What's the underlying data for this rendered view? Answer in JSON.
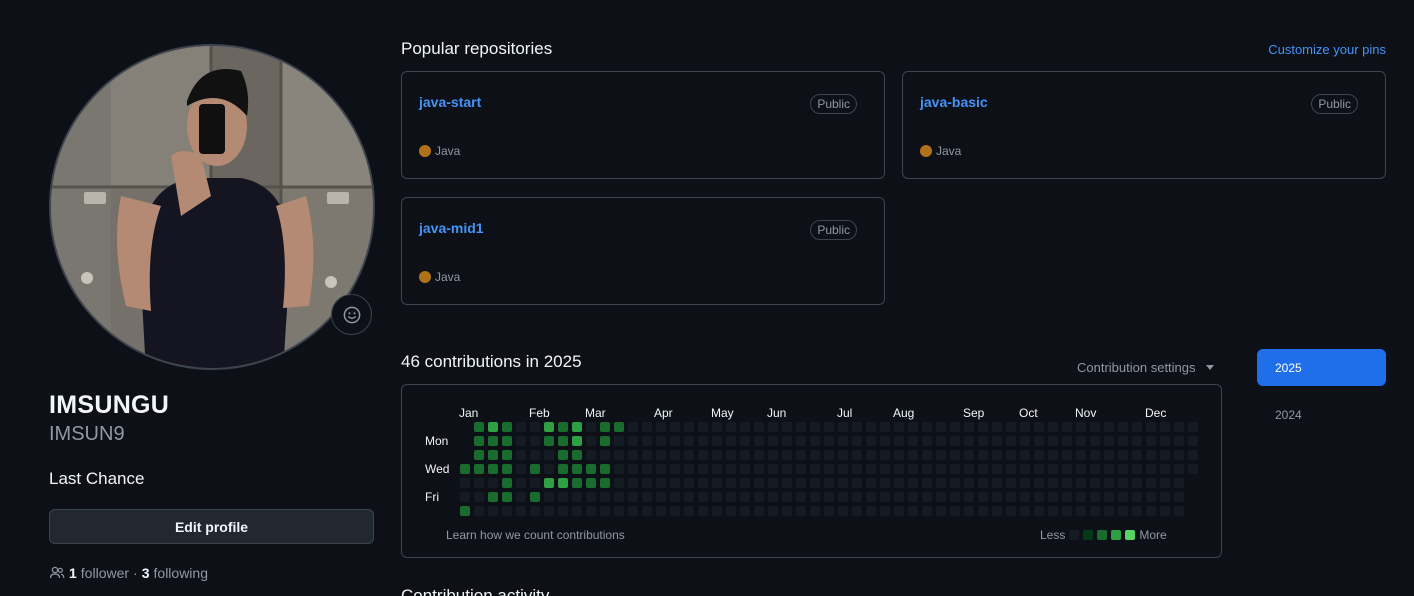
{
  "profile": {
    "full_name": "IMSUNGU",
    "username": "IMSUN9",
    "bio": "Last Chance",
    "edit_label": "Edit profile",
    "followers_count": "1",
    "followers_label": "follower",
    "separator": "·",
    "following_count": "3",
    "following_label": "following",
    "emoji_icon": "smiley-icon"
  },
  "pinned": {
    "title": "Popular repositories",
    "customize_label": "Customize your pins",
    "repos": [
      {
        "name": "java-start",
        "visibility": "Public",
        "language": "Java",
        "lang_color": "#b07219"
      },
      {
        "name": "java-basic",
        "visibility": "Public",
        "language": "Java",
        "lang_color": "#b07219"
      },
      {
        "name": "java-mid1",
        "visibility": "Public",
        "language": "Java",
        "lang_color": "#b07219"
      }
    ]
  },
  "contributions": {
    "title": "46 contributions in 2025",
    "settings_label": "Contribution settings",
    "months": [
      "Jan",
      "Feb",
      "Mar",
      "Apr",
      "May",
      "Jun",
      "Jul",
      "Aug",
      "Sep",
      "Oct",
      "Nov",
      "Dec"
    ],
    "day_labels": [
      "Mon",
      "Wed",
      "Fri"
    ],
    "learn_label": "Learn how we count contributions",
    "legend_less": "Less",
    "legend_more": "More",
    "level_colors": [
      "#151b23",
      "#033a16",
      "#196c2e",
      "#2ea043",
      "#56d364"
    ],
    "weeks": [
      [
        0,
        0,
        0,
        2,
        0,
        0,
        2
      ],
      [
        2,
        2,
        2,
        2,
        0,
        0,
        0
      ],
      [
        3,
        2,
        2,
        2,
        0,
        2,
        0
      ],
      [
        2,
        2,
        2,
        2,
        2,
        2,
        0
      ],
      [
        0,
        0,
        0,
        0,
        0,
        0,
        0
      ],
      [
        0,
        0,
        0,
        2,
        0,
        2,
        0
      ],
      [
        3,
        2,
        0,
        0,
        3,
        0,
        0
      ],
      [
        2,
        2,
        2,
        2,
        3,
        0,
        0
      ],
      [
        3,
        3,
        2,
        2,
        2,
        0,
        0
      ],
      [
        0,
        0,
        0,
        2,
        2,
        0,
        0
      ],
      [
        2,
        2,
        0,
        2,
        2,
        0,
        0
      ],
      [
        2,
        0,
        0,
        0,
        0,
        0,
        0
      ]
    ],
    "years": [
      "2025",
      "2024"
    ]
  },
  "activity": {
    "title": "Contribution activity"
  }
}
